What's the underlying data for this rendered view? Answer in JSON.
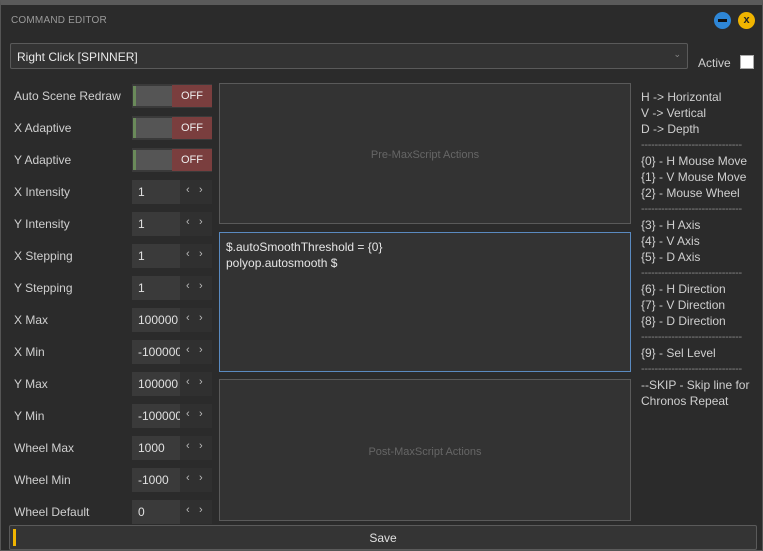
{
  "window": {
    "title": "COMMAND EDITOR",
    "minimize_icon": "minimize-icon",
    "close_label": "x"
  },
  "command": {
    "selected": "Right Click [SPINNER]",
    "active_label": "Active",
    "active_checked": false
  },
  "toggles": [
    {
      "label": "Auto Scene Redraw",
      "state": "OFF"
    },
    {
      "label": "X Adaptive",
      "state": "OFF"
    },
    {
      "label": "Y Adaptive",
      "state": "OFF"
    }
  ],
  "fields": [
    {
      "label": "X Intensity",
      "value": "1"
    },
    {
      "label": "Y Intensity",
      "value": "1"
    },
    {
      "label": "X Stepping",
      "value": "1"
    },
    {
      "label": "Y Stepping",
      "value": "1"
    },
    {
      "label": "X Max",
      "value": "100000"
    },
    {
      "label": "X Min",
      "value": "-100000"
    },
    {
      "label": "Y Max",
      "value": "100000"
    },
    {
      "label": "Y Min",
      "value": "-100000"
    },
    {
      "label": "Wheel Max",
      "value": "1000"
    },
    {
      "label": "Wheel Min",
      "value": "-1000"
    },
    {
      "label": "Wheel Default",
      "value": "0"
    }
  ],
  "spinner_arrows": {
    "left": "‹",
    "right": "›"
  },
  "editor": {
    "pre_placeholder": "Pre-MaxScript Actions",
    "code": "$.autoSmoothThreshold = {0}\npolyop.autosmooth $",
    "post_placeholder": "Post-MaxScript Actions"
  },
  "help": {
    "lines": [
      "H -> Horizontal",
      "V -> Vertical",
      "D -> Depth",
      "------------------------------",
      "{0} - H Mouse Move",
      "{1} - V Mouse Move",
      "{2} - Mouse Wheel",
      "------------------------------",
      "{3} - H Axis",
      "{4} - V Axis",
      "{5} - D Axis",
      "------------------------------",
      "{6} - H Direction",
      "{7} - V Direction",
      "{8} - D Direction",
      "------------------------------",
      "{9} - Sel Level",
      "------------------------------",
      "--SKIP - Skip line for",
      "Chronos Repeat"
    ]
  },
  "footer": {
    "save_label": "Save"
  },
  "colors": {
    "accent": "#f0b400",
    "minimize": "#2e86d6",
    "toggle_off": "#7a3e3e",
    "focus_border": "#5a8ac0"
  }
}
